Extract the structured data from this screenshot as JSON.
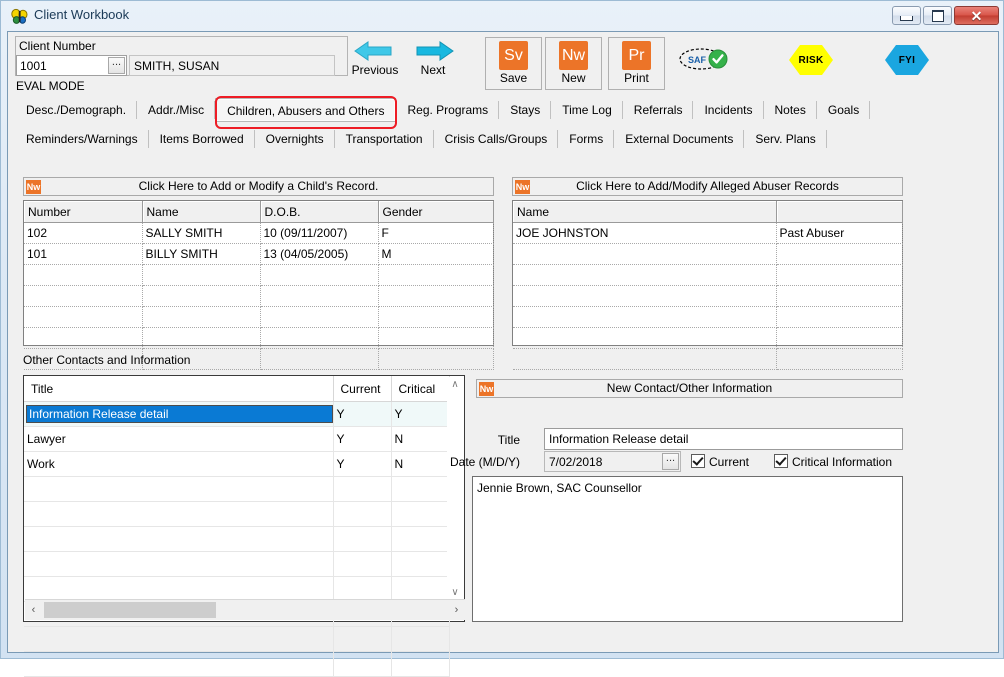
{
  "window": {
    "title": "Client Workbook",
    "app_icon": "butterfly-icon",
    "controls": {
      "minimize": "minimize-icon",
      "maximize": "maximize-icon",
      "close": "close-icon"
    }
  },
  "client": {
    "label": "Client Number",
    "number": "1001",
    "lookup_button": "...",
    "name": "SMITH, SUSAN",
    "mode": "EVAL MODE"
  },
  "nav": {
    "previous": "Previous",
    "next": "Next"
  },
  "toolbar": {
    "buttons": [
      {
        "icon_text": "Sv",
        "label": "Save",
        "name": "save-button"
      },
      {
        "icon_text": "Nw",
        "label": "New",
        "name": "new-button"
      },
      {
        "icon_text": "Pr",
        "label": "Print",
        "name": "print-button"
      }
    ],
    "saf_label": "SAF",
    "risk_label": "RISK",
    "fyi_label": "FYI",
    "risk_color": "#ffff00",
    "fyi_color": "#1aa6e0",
    "accent_color": "#ec7428"
  },
  "tabs": {
    "active": "Children, Abusers and Others",
    "highlight_color": "#ee1c25",
    "row1": [
      "Desc./Demograph.",
      "Addr./Misc",
      "Children, Abusers and Others",
      "Reg. Programs",
      "Stays",
      "Time Log",
      "Referrals",
      "Incidents",
      "Notes",
      "Goals"
    ],
    "row2": [
      "Reminders/Warnings",
      "Items Borrowed",
      "Overnights",
      "Transportation",
      "Crisis Calls/Groups",
      "Forms",
      "External Documents",
      "Serv. Plans"
    ]
  },
  "children_panel": {
    "banner": "Click Here to Add or Modify a Child's Record.",
    "banner_icon": "Nw",
    "columns": [
      "Number",
      "Name",
      "D.O.B.",
      "Gender"
    ],
    "rows": [
      [
        "102",
        "SALLY SMITH",
        "10 (09/11/2007)",
        "F"
      ],
      [
        "101",
        "BILLY SMITH",
        "13 (04/05/2005)",
        "M"
      ]
    ],
    "empty_rows": 5
  },
  "abusers_panel": {
    "banner": "Click Here to Add/Modify Alleged Abuser Records",
    "banner_icon": "Nw",
    "columns": [
      "Name",
      ""
    ],
    "rows": [
      [
        "JOE JOHNSTON",
        "Past Abuser"
      ]
    ],
    "empty_rows": 6
  },
  "other_contacts": {
    "section_label": "Other Contacts and Information",
    "columns": [
      "Title",
      "Current",
      "Critical"
    ],
    "rows": [
      {
        "title": "Information Release detail",
        "current": "Y",
        "critical": "Y",
        "selected": true
      },
      {
        "title": "Lawyer",
        "current": "Y",
        "critical": "N",
        "selected": false
      },
      {
        "title": "Work",
        "current": "Y",
        "critical": "N",
        "selected": false
      }
    ],
    "empty_rows": 8,
    "scroll_up": "∧",
    "scroll_down": "∨",
    "scroll_left": "‹",
    "scroll_right": "›"
  },
  "detail": {
    "banner": "New Contact/Other Information",
    "banner_icon": "Nw",
    "title_label": "Title",
    "title_value": "Information Release detail",
    "date_label": "Date (M/D/Y)",
    "date_value": "7/02/2018",
    "date_lookup": "...",
    "current_label": "Current",
    "current_checked": true,
    "critical_label": "Critical Information",
    "critical_checked": true,
    "memo_value": "Jennie Brown, SAC Counsellor"
  }
}
